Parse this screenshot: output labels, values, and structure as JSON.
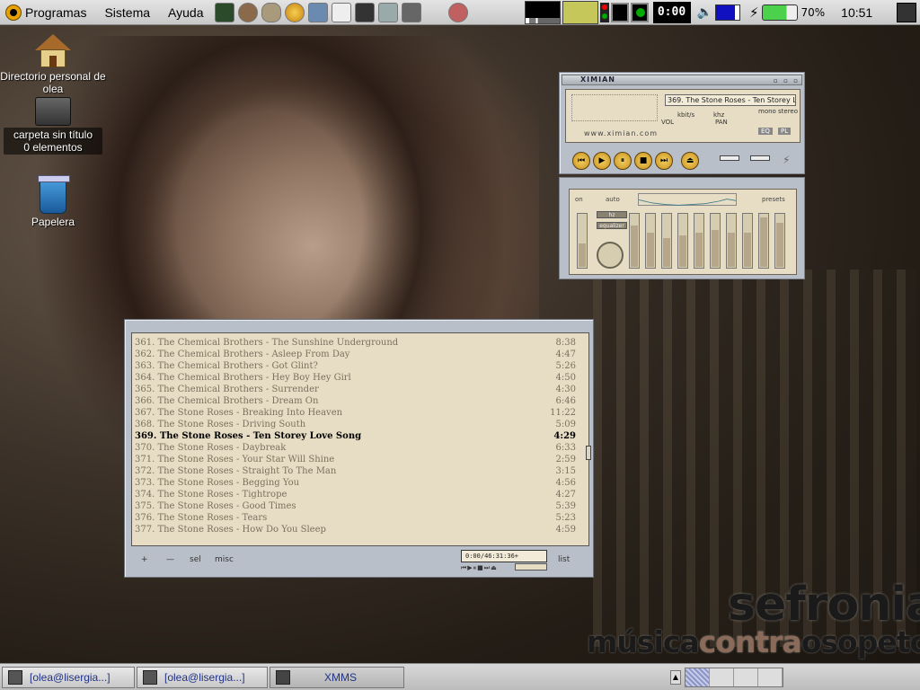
{
  "top_panel": {
    "menus": [
      "Programas",
      "Sistema",
      "Ayuda"
    ],
    "clock_display": "0:00",
    "battery_percent": "70%",
    "time": "10:51"
  },
  "desktop": {
    "icons": [
      {
        "label": "Directorio personal de olea"
      },
      {
        "label": "carpeta sin título",
        "sublabel": "0 elementos"
      },
      {
        "label": "Papelera"
      }
    ]
  },
  "xmms_main": {
    "title": "XIMIAN",
    "song_ticker": "369. The Stone Roses - Ten Storey Love",
    "site": "www.ximian.com",
    "labels": {
      "kbps": "kbit/s",
      "khz": "khz",
      "mono": "mono",
      "stereo": "stereo",
      "vol": "VOL",
      "pan": "PAN",
      "eq": "EQ",
      "pl": "PL"
    }
  },
  "xmms_eq": {
    "on_label": "on",
    "auto_label": "auto",
    "presets_label": "presets",
    "preamp_label": "hz",
    "equalizer_label": "equalizer",
    "band_levels": [
      0.45,
      0.8,
      0.65,
      0.55,
      0.6,
      0.65,
      0.7,
      0.65,
      0.65,
      0.95,
      0.85
    ]
  },
  "playlist": {
    "tracks": [
      {
        "title": "361. The Chemical Brothers - The Sunshine Underground",
        "duration": "8:38"
      },
      {
        "title": "362. The Chemical Brothers - Asleep From Day",
        "duration": "4:47"
      },
      {
        "title": "363. The Chemical Brothers - Got Glint?",
        "duration": "5:26"
      },
      {
        "title": "364. The Chemical Brothers - Hey Boy Hey Girl",
        "duration": "4:50"
      },
      {
        "title": "365. The Chemical Brothers - Surrender",
        "duration": "4:30"
      },
      {
        "title": "366. The Chemical Brothers - Dream On",
        "duration": "6:46"
      },
      {
        "title": "367. The Stone Roses - Breaking Into Heaven",
        "duration": "11:22"
      },
      {
        "title": "368. The Stone Roses - Driving South",
        "duration": "5:09"
      },
      {
        "title": "369. The Stone Roses - Ten Storey Love Song",
        "duration": "4:29",
        "current": true
      },
      {
        "title": "370. The Stone Roses - Daybreak",
        "duration": "6:33"
      },
      {
        "title": "371. The Stone Roses - Your Star Will Shine",
        "duration": "2:59"
      },
      {
        "title": "372. The Stone Roses - Straight To The Man",
        "duration": "3:15"
      },
      {
        "title": "373. The Stone Roses - Begging You",
        "duration": "4:56"
      },
      {
        "title": "374. The Stone Roses - Tightrope",
        "duration": "4:27"
      },
      {
        "title": "375. The Stone Roses - Good Times",
        "duration": "5:39"
      },
      {
        "title": "376. The Stone Roses - Tears",
        "duration": "5:23"
      },
      {
        "title": "377. The Stone Roses - How Do You Sleep",
        "duration": "4:59"
      }
    ],
    "buttons": {
      "add": "+",
      "remove": "—",
      "sel": "sel",
      "misc": "misc",
      "list": "list"
    },
    "time_display": "0:00/46:31:36+"
  },
  "wallpaper": {
    "brand": "sefronia",
    "tagline_a": "música",
    "tagline_b": "contra",
    "tagline_c": "osopetos"
  },
  "taskbar": {
    "tasks": [
      "[olea@lisergia...]",
      "[olea@lisergia...]",
      "XMMS"
    ]
  }
}
